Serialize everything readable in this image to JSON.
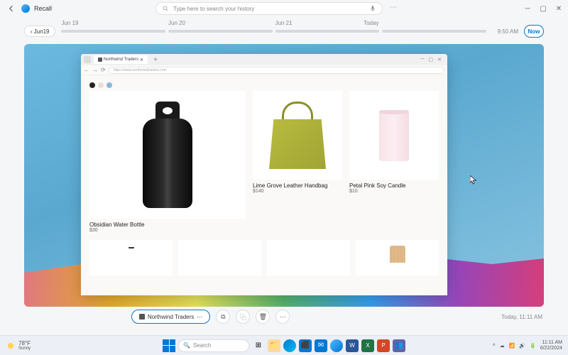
{
  "titlebar": {
    "app_name": "Recall",
    "search_placeholder": "Type here to search your history"
  },
  "timeline": {
    "back_label": "Jun19",
    "dates": [
      "Jun 19",
      "Jun 20",
      "Jun 21",
      "Today"
    ],
    "time": "9:50 AM",
    "now_label": "Now"
  },
  "browser": {
    "tab_title": "Northwind Traders",
    "url": "https://www.northwindtraders.com"
  },
  "swatches": [
    "#222222",
    "#e8e0d5",
    "#8ab8d8"
  ],
  "products": [
    {
      "name": "Obsidian Water Bottle",
      "price": "$30"
    },
    {
      "name": "Lime Grove Leather Handbag",
      "price": "$140"
    },
    {
      "name": "Petal Pink Soy Candle",
      "price": "$10"
    }
  ],
  "bottom_bar": {
    "app": "Northwind Traders",
    "timestamp": "Today, 11:11 AM"
  },
  "taskbar": {
    "weather_temp": "78°F",
    "weather_cond": "Sunny",
    "search": "Search",
    "time": "11:11 AM",
    "date": "6/22/2024"
  }
}
